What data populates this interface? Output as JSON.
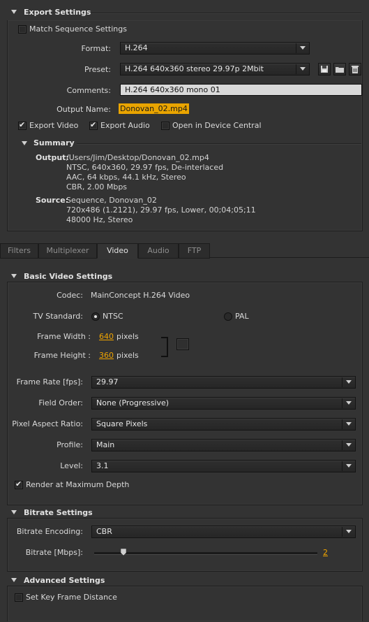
{
  "export_settings": {
    "header": "Export Settings",
    "match_sequence": {
      "label": "Match Sequence Settings",
      "checked": false
    },
    "format": {
      "label": "Format:",
      "value": "H.264"
    },
    "preset": {
      "label": "Preset:",
      "value": "H.264 640x360 stereo 29.97p 2Mbit",
      "icons": [
        "save-preset-icon",
        "import-preset-icon",
        "delete-preset-icon"
      ]
    },
    "comments": {
      "label": "Comments:",
      "value": "H.264 640x360 mono 01"
    },
    "output_name": {
      "label": "Output Name:",
      "value": "Donovan_02.mp4"
    },
    "export_video": {
      "label": "Export Video",
      "checked": true
    },
    "export_audio": {
      "label": "Export Audio",
      "checked": true
    },
    "open_device_central": {
      "label": "Open in Device Central",
      "checked": false
    },
    "summary": {
      "header": "Summary",
      "output_label": "Output:",
      "output_lines": [
        "/Users/Jim/Desktop/Donovan_02.mp4",
        "NTSC, 640x360, 29.97 fps, De-interlaced",
        "AAC, 64 kbps, 44.1 kHz, Stereo",
        "CBR, 2.00 Mbps"
      ],
      "source_label": "Source:",
      "source_lines": [
        "Sequence, Donovan_02",
        "720x486 (1.2121), 29.97 fps, Lower, 00;04;05;11",
        "48000 Hz, Stereo"
      ]
    }
  },
  "tabs": [
    {
      "label": "Filters",
      "active": false
    },
    {
      "label": "Multiplexer",
      "active": false
    },
    {
      "label": "Video",
      "active": true
    },
    {
      "label": "Audio",
      "active": false
    },
    {
      "label": "FTP",
      "active": false
    }
  ],
  "basic_video": {
    "header": "Basic Video Settings",
    "codec": {
      "label": "Codec:",
      "value": "MainConcept H.264 Video"
    },
    "tv_standard": {
      "label": "TV Standard:",
      "options": [
        "NTSC",
        "PAL"
      ],
      "selected": "NTSC"
    },
    "frame_width": {
      "label": "Frame Width :",
      "value": "640",
      "unit": "pixels"
    },
    "frame_height": {
      "label": "Frame Height :",
      "value": "360",
      "unit": "pixels"
    },
    "frame_rate": {
      "label": "Frame Rate [fps]:",
      "value": "29.97"
    },
    "field_order": {
      "label": "Field Order:",
      "value": "None (Progressive)"
    },
    "pixel_aspect": {
      "label": "Pixel Aspect Ratio:",
      "value": "Square Pixels"
    },
    "profile": {
      "label": "Profile:",
      "value": "Main"
    },
    "level": {
      "label": "Level:",
      "value": "3.1"
    },
    "render_max_depth": {
      "label": "Render at Maximum Depth",
      "checked": true
    }
  },
  "bitrate": {
    "header": "Bitrate Settings",
    "encoding": {
      "label": "Bitrate Encoding:",
      "value": "CBR"
    },
    "bitrate": {
      "label": "Bitrate [Mbps]:",
      "value": "2",
      "slider_fraction": 0.13
    }
  },
  "advanced": {
    "header": "Advanced Settings",
    "key_frame": {
      "label": "Set Key Frame Distance",
      "checked": false
    }
  }
}
